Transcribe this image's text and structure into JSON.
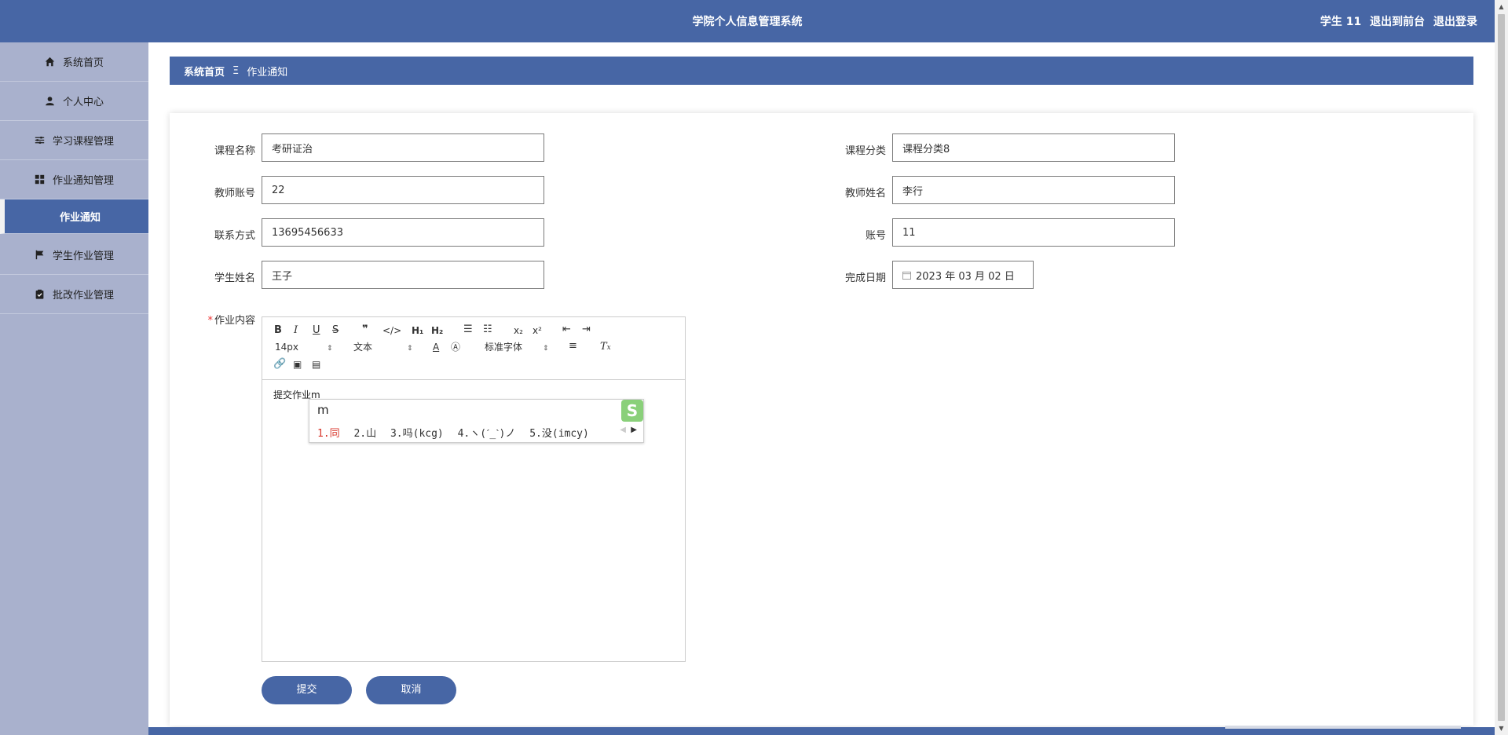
{
  "header": {
    "title": "学院个人信息管理系统",
    "user_label": "学生 11",
    "front_label": "退出到前台",
    "logout_label": "退出登录"
  },
  "sidebar": {
    "items": [
      {
        "label": "系统首页",
        "icon": "home-icon"
      },
      {
        "label": "个人中心",
        "icon": "user-icon"
      },
      {
        "label": "学习课程管理",
        "icon": "sliders-icon"
      },
      {
        "label": "作业通知管理",
        "icon": "grid-icon"
      },
      {
        "label": "作业通知",
        "icon": ""
      },
      {
        "label": "学生作业管理",
        "icon": "flag-icon"
      },
      {
        "label": "批改作业管理",
        "icon": "clipboard-check-icon"
      }
    ]
  },
  "breadcrumb": {
    "home": "系统首页",
    "separator": "Ξ",
    "current": "作业通知"
  },
  "form": {
    "course_name": {
      "label": "课程名称",
      "value": "考研证治"
    },
    "course_category": {
      "label": "课程分类",
      "value": "课程分类8"
    },
    "teacher_account": {
      "label": "教师账号",
      "value": "22"
    },
    "teacher_name": {
      "label": "教师姓名",
      "value": "李行"
    },
    "contact": {
      "label": "联系方式",
      "value": "13695456633"
    },
    "account": {
      "label": "账号",
      "value": "11"
    },
    "student_name": {
      "label": "学生姓名",
      "value": "王子"
    },
    "finish_date": {
      "label": "完成日期",
      "value": "2023 年 03 月 02 日"
    },
    "content": {
      "label": "作业内容",
      "required_mark": "*"
    }
  },
  "editor": {
    "font_size": "14px",
    "paragraph": "文本",
    "font_family": "标准字体",
    "body_text": "提交作业m"
  },
  "ime": {
    "composition": "m",
    "candidates": [
      "1.同",
      "2.山",
      "3.吗(kcg)",
      "4.ヽ(ˊ_ˋ)ノ",
      "5.没(imcy)"
    ]
  },
  "buttons": {
    "submit": "提交",
    "cancel": "取消"
  },
  "colors": {
    "primary": "#4766a5",
    "sidebar": "#a9b1cd"
  }
}
